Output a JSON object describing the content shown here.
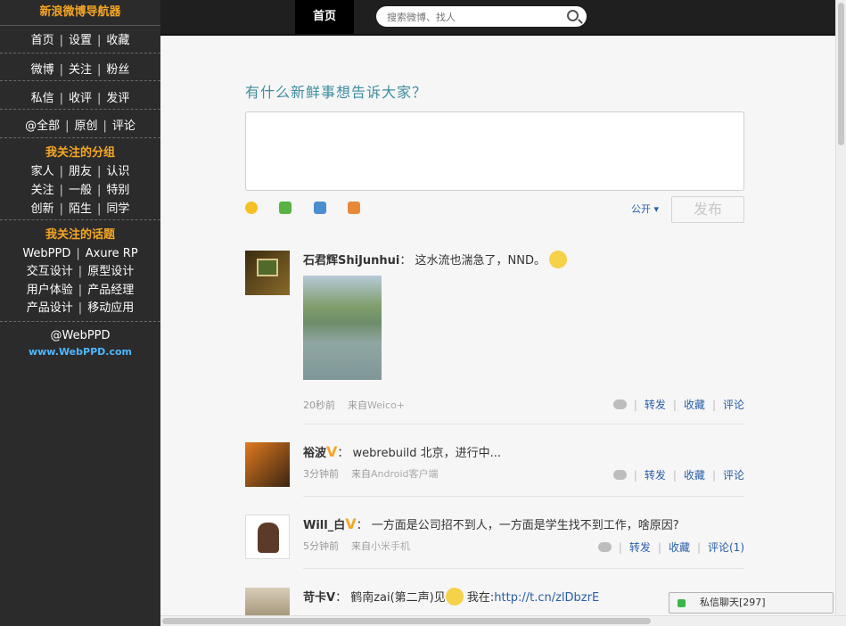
{
  "sidebar": {
    "title": "新浪微博导航器",
    "rows": [
      [
        "首页",
        "设置",
        "收藏"
      ],
      [
        "微博",
        "关注",
        "粉丝"
      ],
      [
        "私信",
        "收评",
        "发评"
      ],
      [
        "@全部",
        "原创",
        "评论"
      ]
    ],
    "groups_heading": "我关注的分组",
    "groups": [
      [
        "家人",
        "朋友",
        "认识"
      ],
      [
        "关注",
        "一般",
        "特别"
      ],
      [
        "创新",
        "陌生",
        "同学"
      ]
    ],
    "topics_heading": "我关注的话题",
    "topics": [
      [
        "WebPPD",
        "Axure RP"
      ],
      [
        "交互设计",
        "原型设计"
      ],
      [
        "用户体验",
        "产品经理"
      ],
      [
        "产品设计",
        "移动应用"
      ]
    ],
    "handle": "@WebPPD",
    "url": "www.WebPPD.com"
  },
  "topbar": {
    "home_label": "首页",
    "search_placeholder": "搜索微博、找人"
  },
  "composer": {
    "prompt": "有什么新鲜事想告诉大家？",
    "visibility": "公开",
    "publish_label": "发布"
  },
  "colors": {
    "accent": "#f5a623",
    "link": "#2a5ea8",
    "sidebar_bg": "#2b2b2b"
  },
  "posts": [
    {
      "author": "石君辉ShiJunhui",
      "text": "这水流也湍急了，NND。",
      "time": "20秒前",
      "source_prefix": "来自",
      "source": "Weico+",
      "actions": {
        "repost": "转发",
        "favorite": "收藏",
        "comment": "评论"
      }
    },
    {
      "author": "裕波",
      "badge": "V",
      "text": "webrebuild 北京，进行中...",
      "time": "3分钟前",
      "source_prefix": "来自",
      "source": "Android客户端",
      "actions": {
        "repost": "转发",
        "favorite": "收藏",
        "comment": "评论"
      }
    },
    {
      "author": "Will_白",
      "badge": "V",
      "text": "一方面是公司招不到人，一方面是学生找不到工作，啥原因?",
      "time": "5分钟前",
      "source_prefix": "来自",
      "source": "小米手机",
      "actions": {
        "repost": "转发",
        "favorite": "收藏",
        "comment": "评论(1)"
      }
    },
    {
      "author": "苛卡V",
      "text_a": "鹤南zai(第二声)见",
      "text_b": "我在:",
      "link": "http://t.cn/zlDbzrE"
    }
  ],
  "chat": {
    "label": "私信聊天[297]"
  }
}
